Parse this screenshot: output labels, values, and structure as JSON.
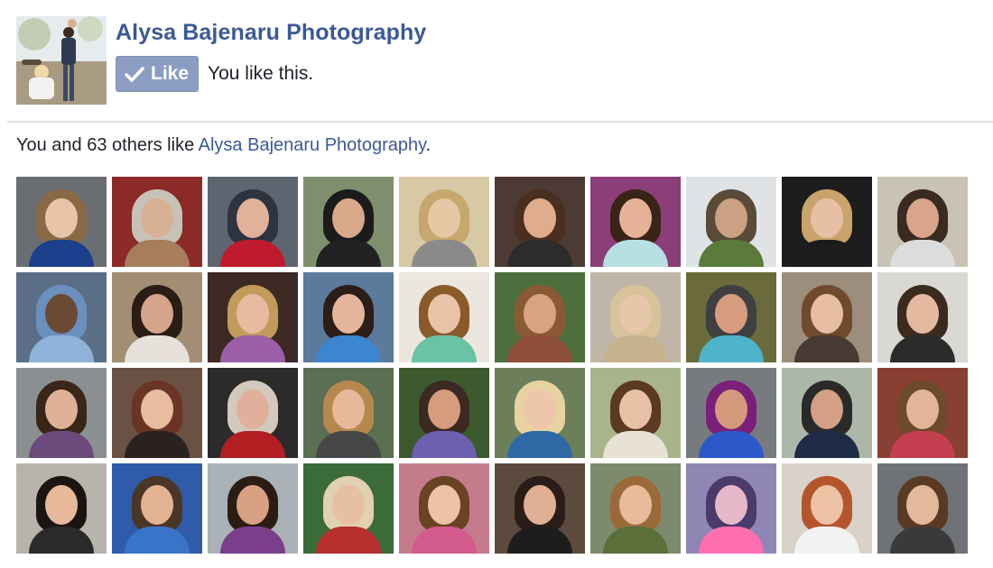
{
  "page": {
    "name": "Alysa Bajenaru Photography",
    "thumbnail_icon": "page-profile-photo"
  },
  "like_button": {
    "label": "Like",
    "icon": "check-icon",
    "liked": true
  },
  "like_status": "You like this.",
  "social_context": {
    "prefix": "You and 63 others like ",
    "page_link": "Alysa Bajenaru Photography",
    "suffix": "."
  },
  "colors": {
    "brand": "#3b5998",
    "like_button_bg": "#8b9dc3",
    "divider": "#dcdfe8"
  },
  "faces": [
    {
      "bg": "#6a6e73",
      "hair": "#8a6a45",
      "skin": "#e9c4a8",
      "body": "#1b3f8a"
    },
    {
      "bg": "#8c2a28",
      "hair": "#c7c2b6",
      "skin": "#d8b194",
      "body": "#a67e5b"
    },
    {
      "bg": "#5d6670",
      "hair": "#2e3340",
      "skin": "#e1b19a",
      "body": "#c01b2c"
    },
    {
      "bg": "#7f8f6d",
      "hair": "#1b1b1b",
      "skin": "#d9a98b",
      "body": "#222222"
    },
    {
      "bg": "#d7c9a4",
      "hair": "#c6a76e",
      "skin": "#e8c7a4",
      "body": "#8a8a8a"
    },
    {
      "bg": "#4e3a34",
      "hair": "#4a2e1f",
      "skin": "#e0ac8e",
      "body": "#2c2c2c"
    },
    {
      "bg": "#8b3e77",
      "hair": "#3a2317",
      "skin": "#e6b297",
      "body": "#b8e0e3"
    },
    {
      "bg": "#dfe3e6",
      "hair": "#5a4a3a",
      "skin": "#caa183",
      "body": "#5a7b3c"
    },
    {
      "bg": "#1d1d1d",
      "hair": "#c9a46a",
      "skin": "#e7c0a3",
      "body": "#1c1c1c"
    },
    {
      "bg": "#c9c3b4",
      "hair": "#3a2a22",
      "skin": "#d8a58a",
      "body": "#dcdcdc"
    },
    {
      "bg": "#5a6e85",
      "hair": "#6b8fbf",
      "skin": "#6b4a34",
      "body": "#8fb3d9"
    },
    {
      "bg": "#a38e74",
      "hair": "#2a1d14",
      "skin": "#d4a58a",
      "body": "#e6e1da"
    },
    {
      "bg": "#3d2a24",
      "hair": "#c09b5c",
      "skin": "#e7bba0",
      "body": "#9b5fa8"
    },
    {
      "bg": "#5b7a9c",
      "hair": "#2b1e17",
      "skin": "#e4b69d",
      "body": "#3b86cf"
    },
    {
      "bg": "#ece7de",
      "hair": "#8b5a2b",
      "skin": "#e8c3a7",
      "body": "#6bc2a6"
    },
    {
      "bg": "#4d6e3d",
      "hair": "#8a5a34",
      "skin": "#d9a283",
      "body": "#8d4e3a"
    },
    {
      "bg": "#bfb6a7",
      "hair": "#d8c29a",
      "skin": "#e6c7a9",
      "body": "#c9b38f"
    },
    {
      "bg": "#6b6a3c",
      "hair": "#3f3f3f",
      "skin": "#d79c80",
      "body": "#4fb3c9"
    },
    {
      "bg": "#9c8d7c",
      "hair": "#6f4a2c",
      "skin": "#e7bea4",
      "body": "#463a33"
    },
    {
      "bg": "#dad8d3",
      "hair": "#3a2a1f",
      "skin": "#e3b99f",
      "body": "#2b2b2b"
    },
    {
      "bg": "#8a8f92",
      "hair": "#3a2519",
      "skin": "#dfb196",
      "body": "#6a4a7a"
    },
    {
      "bg": "#6b5044",
      "hair": "#6a3524",
      "skin": "#e8bca0",
      "body": "#2a2220"
    },
    {
      "bg": "#2b2b2b",
      "hair": "#d3c9bd",
      "skin": "#e1b09a",
      "body": "#b21f23"
    },
    {
      "bg": "#5b6f52",
      "hair": "#b7884e",
      "skin": "#e7b89a",
      "body": "#474747"
    },
    {
      "bg": "#3c5a2e",
      "hair": "#3b2a21",
      "skin": "#d59c7d",
      "body": "#6e5fb0"
    },
    {
      "bg": "#6c7f5a",
      "hair": "#e7d3a0",
      "skin": "#eec6ab",
      "body": "#2e69a6"
    },
    {
      "bg": "#a9b48a",
      "hair": "#5a3a22",
      "skin": "#e7c0a5",
      "body": "#e8e2d6"
    },
    {
      "bg": "#787b7e",
      "hair": "#7a1f7a",
      "skin": "#d39a7c",
      "body": "#2c58c9"
    },
    {
      "bg": "#adb7a9",
      "hair": "#2a2a2a",
      "skin": "#d3a086",
      "body": "#1f2a44"
    },
    {
      "bg": "#8a3f33",
      "hair": "#6d4a2c",
      "skin": "#e2b498",
      "body": "#c43f4f"
    },
    {
      "bg": "#b8b3ab",
      "hair": "#1a1512",
      "skin": "#e7b99a",
      "body": "#2a2a2a"
    },
    {
      "bg": "#2f5ba8",
      "hair": "#4a3626",
      "skin": "#e2b293",
      "body": "#3a74c9"
    },
    {
      "bg": "#aab2b7",
      "hair": "#2b1c14",
      "skin": "#d9a184",
      "body": "#7a3f8a"
    },
    {
      "bg": "#3c6b3a",
      "hair": "#e0d1b0",
      "skin": "#e7bfa2",
      "body": "#b72e2e"
    },
    {
      "bg": "#c47c8c",
      "hair": "#6a4224",
      "skin": "#edc3a6",
      "body": "#d25a8c"
    },
    {
      "bg": "#5d4a3e",
      "hair": "#2a1d17",
      "skin": "#e1af93",
      "body": "#1d1d1d"
    },
    {
      "bg": "#7e8a6c",
      "hair": "#9a6a3a",
      "skin": "#e9bb9a",
      "body": "#5a6f3a"
    },
    {
      "bg": "#8f86b5",
      "hair": "#4a3b6b",
      "skin": "#e7b8c9",
      "body": "#ff6fb0"
    },
    {
      "bg": "#d8d2c8",
      "hair": "#b4562c",
      "skin": "#eec2a4",
      "body": "#f2f2f2"
    },
    {
      "bg": "#6f7378",
      "hair": "#5a3a24",
      "skin": "#e4b89b",
      "body": "#3a3a3a"
    }
  ]
}
